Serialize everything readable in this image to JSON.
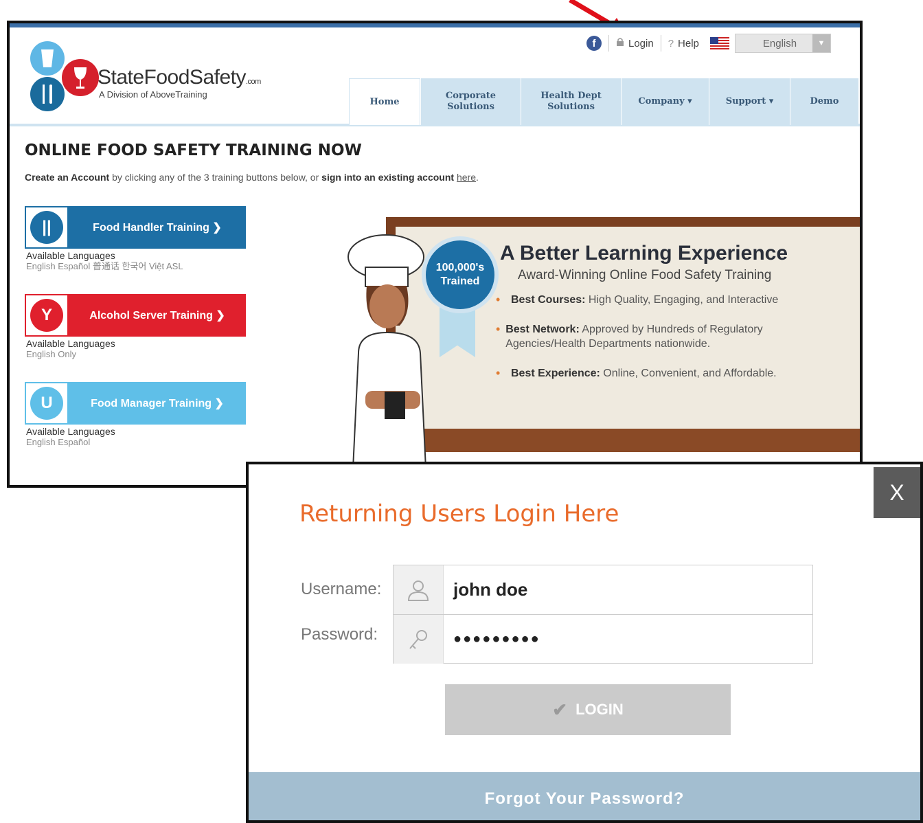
{
  "header": {
    "brand_name": "StateFoodSafety",
    "brand_tm": ".com",
    "brand_sub": "A Division of AboveTraining",
    "facebook_glyph": "f",
    "login_label": "Login",
    "help_label": "Help",
    "language_value": "English"
  },
  "nav": {
    "tabs": [
      {
        "label": "Home"
      },
      {
        "label": "Corporate Solutions"
      },
      {
        "label": "Health Dept Solutions"
      },
      {
        "label": "Company ▾"
      },
      {
        "label": "Support ▾"
      },
      {
        "label": "Demo"
      }
    ]
  },
  "main": {
    "headline": "ONLINE FOOD SAFETY TRAINING NOW",
    "intro_part1": "Create an Account",
    "intro_part2": " by clicking any of the 3 training buttons below, or ",
    "intro_part3": "sign into an existing account",
    "intro_link": "here",
    "trainings": [
      {
        "label": "Food Handler Training  ❯",
        "avail_label": "Available Languages",
        "languages": "English  Español  普通话  한국어  Việt  ASL",
        "color": "#1d6fa5"
      },
      {
        "label": "Alcohol Server Training  ❯",
        "avail_label": "Available Languages",
        "languages": "English Only",
        "color": "#e0202d"
      },
      {
        "label": "Food Manager Training  ❯",
        "avail_label": "Available Languages",
        "languages": "English  Español",
        "color": "#5fbfe8"
      }
    ]
  },
  "board": {
    "badge_line1": "100,000's",
    "badge_line2": "Trained",
    "title": "A Better Learning Experience",
    "subtitle": "Award-Winning Online Food Safety Training",
    "bullets": [
      {
        "bold": "Best Courses:",
        "text": " High Quality, Engaging, and Interactive"
      },
      {
        "bold": "Best Network:",
        "text": " Approved by Hundreds of Regulatory Agencies/Health Departments nationwide."
      },
      {
        "bold": "Best Experience:",
        "text": " Online, Convenient, and Affordable."
      }
    ]
  },
  "modal": {
    "close_label": "X",
    "title": "Returning Users Login Here",
    "username_label": "Username:",
    "username_value": "john doe",
    "password_label": "Password:",
    "password_value": "●●●●●●●●●",
    "login_label": "LOGIN",
    "forgot_label": "Forgot Your Password?"
  },
  "colors": {
    "accent_orange": "#e96b2b",
    "brand_blue": "#1d6fa5",
    "forgot_bar": "#a3bed0"
  }
}
